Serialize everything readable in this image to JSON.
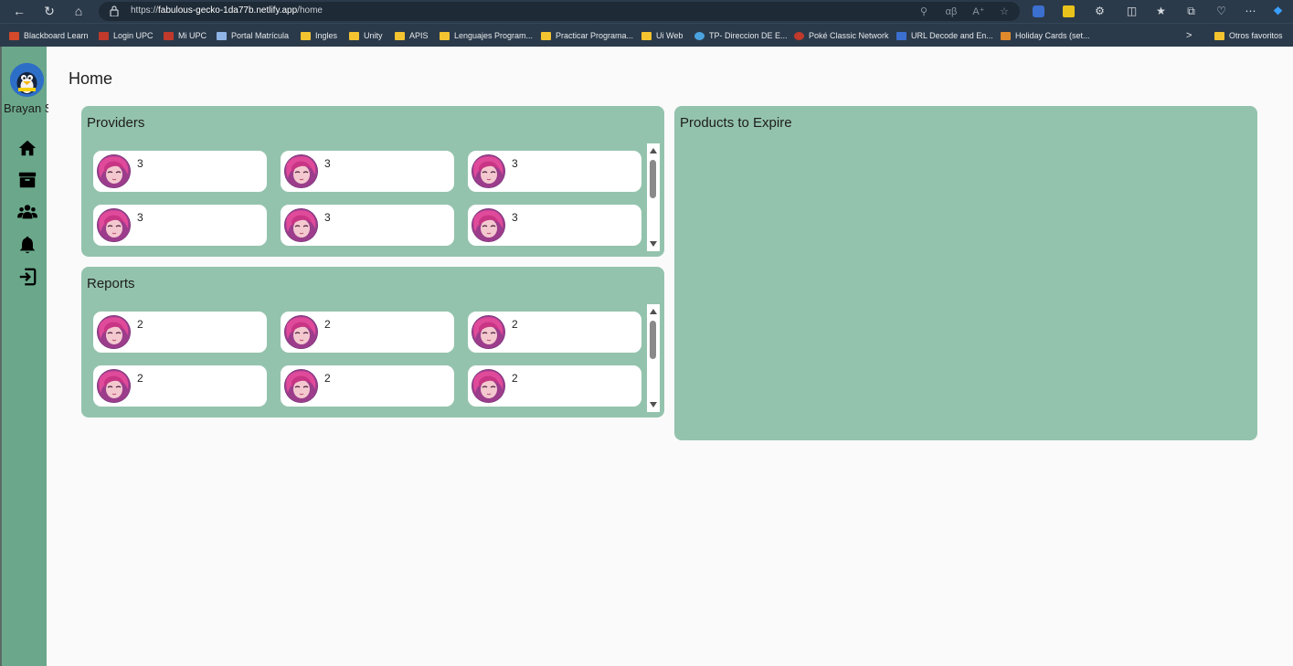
{
  "browser": {
    "url_prefix": "https://",
    "url_host": "fabulous-gecko-1da77b.netlify.app",
    "url_path": "/home",
    "bookmarks": [
      {
        "label": "Blackboard Learn",
        "color": "#d44a2a"
      },
      {
        "label": "Login UPC",
        "color": "#c0392b"
      },
      {
        "label": "Mi UPC",
        "color": "#c0392b"
      },
      {
        "label": "Portal Matrícula",
        "color": "#8fb4e6"
      },
      {
        "label": "Ingles",
        "color": "#f4c430"
      },
      {
        "label": "Unity",
        "color": "#f4c430"
      },
      {
        "label": "APIS",
        "color": "#f4c430"
      },
      {
        "label": "Lenguajes Program...",
        "color": "#f4c430"
      },
      {
        "label": "Practicar Programa...",
        "color": "#f4c430"
      },
      {
        "label": "Ui Web",
        "color": "#f4c430"
      },
      {
        "label": "TP- Direccion DE E...",
        "color": "#4aa3df"
      },
      {
        "label": "Poké Classic Network",
        "color": "#c0392b"
      },
      {
        "label": "URL Decode and En...",
        "color": "#3b6fd0"
      },
      {
        "label": "Holiday Cards (set...",
        "color": "#e08a2c"
      }
    ],
    "more_bookmarks_chevron": ">",
    "other_favorites": "Otros favoritos"
  },
  "user": {
    "name": "Brayan S"
  },
  "sidebar": {
    "items": [
      {
        "icon": "home-icon"
      },
      {
        "icon": "archive-icon"
      },
      {
        "icon": "users-icon"
      },
      {
        "icon": "bell-icon"
      },
      {
        "icon": "logout-icon"
      }
    ]
  },
  "page": {
    "title": "Home"
  },
  "providers": {
    "title": "Providers",
    "items": [
      "3",
      "3",
      "3",
      "3",
      "3",
      "3"
    ]
  },
  "reports": {
    "title": "Reports",
    "items": [
      "2",
      "2",
      "2",
      "2",
      "2",
      "2"
    ]
  },
  "expire": {
    "title": "Products to Expire"
  },
  "colors": {
    "sidebar": "#6ba88b",
    "card": "#94c3ad",
    "browser": "#2b3a4a"
  }
}
